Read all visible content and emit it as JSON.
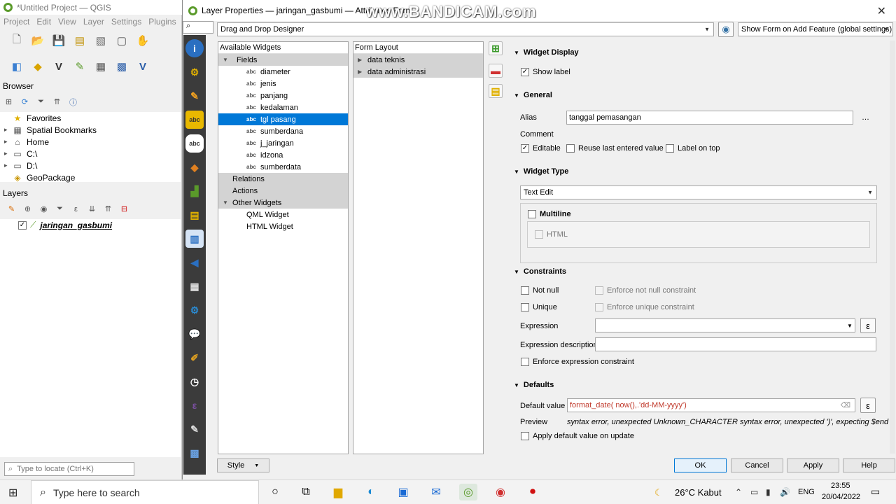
{
  "qgis": {
    "title": "*Untitled Project — QGIS",
    "menu": [
      "Project",
      "Edit",
      "View",
      "Layer",
      "Settings",
      "Plugins"
    ],
    "browser_title": "Browser",
    "browser_items": [
      {
        "label": "Favorites",
        "icon": "★"
      },
      {
        "label": "Spatial Bookmarks",
        "icon": "▦"
      },
      {
        "label": "Home",
        "icon": "⌂"
      },
      {
        "label": "C:\\",
        "icon": "▭"
      },
      {
        "label": "D:\\",
        "icon": "▭"
      },
      {
        "label": "GeoPackage",
        "icon": "◈"
      }
    ],
    "layers_title": "Layers",
    "layer_name": "jaringan_gasbumi",
    "locator_placeholder": "Type to locate (Ctrl+K)"
  },
  "dialog": {
    "title": "Layer Properties — jaringan_gasbumi — Attributes Form",
    "watermark": "www.BANDICAM.com",
    "designer_mode": "Drag and Drop Designer",
    "show_form_mode": "Show Form on Add Feature (global settings)",
    "available_widgets_header": "Available Widgets",
    "fields_label": "Fields",
    "fields": [
      "diameter",
      "jenis",
      "panjang",
      "kedalaman",
      "tgl pasang",
      "sumberdana",
      "j_jaringan",
      "idzona",
      "sumberdata"
    ],
    "field_type_tag": "abc",
    "relations_label": "Relations",
    "actions_label": "Actions",
    "other_widgets_label": "Other Widgets",
    "other_widgets": [
      "QML Widget",
      "HTML Widget"
    ],
    "form_layout_header": "Form Layout",
    "form_layout_items": [
      "data teknis",
      "data administrasi"
    ],
    "widget_display": {
      "header": "Widget Display",
      "show_label": "Show label"
    },
    "general": {
      "header": "General",
      "alias_label": "Alias",
      "alias_value": "tanggal pemasangan",
      "more": "…",
      "comment_label": "Comment",
      "editable": "Editable",
      "reuse_last": "Reuse last entered value",
      "label_on_top": "Label on top"
    },
    "widget_type": {
      "header": "Widget Type",
      "value": "Text Edit",
      "multiline": "Multiline",
      "html": "HTML"
    },
    "constraints": {
      "header": "Constraints",
      "not_null": "Not null",
      "enforce_not_null": "Enforce not null constraint",
      "unique": "Unique",
      "enforce_unique": "Enforce unique constraint",
      "expression_label": "Expression",
      "expression_desc_label": "Expression description",
      "enforce_expression": "Enforce expression constraint"
    },
    "defaults": {
      "header": "Defaults",
      "default_value_label": "Default value",
      "default_value": "format_date( now(),.'dd-MM-yyyy')",
      "preview_label": "Preview",
      "preview_text": "syntax error, unexpected Unknown_CHARACTER syntax error, unexpected ')', expecting $end",
      "apply_on_update": "Apply default value on update"
    },
    "buttons": {
      "style": "Style",
      "ok": "OK",
      "cancel": "Cancel",
      "apply": "Apply",
      "help": "Help"
    },
    "epsilon": "ε"
  },
  "taskbar": {
    "search_placeholder": "Type here to search",
    "weather": "26°C  Kabut",
    "lang": "ENG",
    "time": "23:55",
    "date": "20/04/2022"
  },
  "colors": {
    "selection": "#0078d7",
    "error_text": "#c0392b",
    "sidebar": "#3b3b3b"
  }
}
